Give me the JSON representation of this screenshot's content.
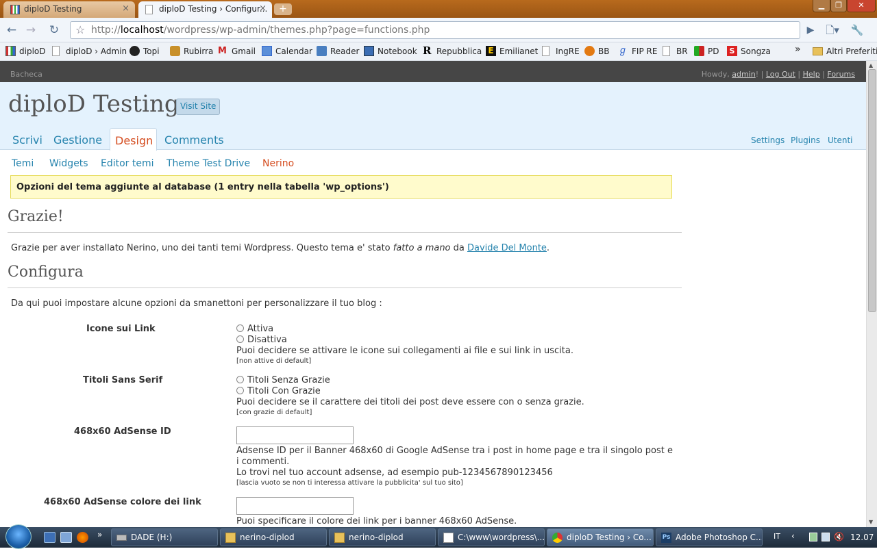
{
  "browser": {
    "tabs": [
      {
        "label": "diploD Testing",
        "active": false
      },
      {
        "label": "diploD Testing › Configur...",
        "active": true
      }
    ],
    "new_tab": "+",
    "url": {
      "prefix": "http://",
      "host": "localhost",
      "path": "/wordpress/wp-admin/themes.php?page=functions.php"
    },
    "bookmarks": [
      {
        "label": "diploD",
        "icon": "bars-icon"
      },
      {
        "label": "diploD › Admin",
        "icon": "page-icon"
      },
      {
        "label": "Topi",
        "icon": "mouse-icon"
      },
      {
        "label": "Rubirra",
        "icon": "crown-icon"
      },
      {
        "label": "Gmail",
        "icon": "gmail-icon"
      },
      {
        "label": "Calendar",
        "icon": "calendar-icon"
      },
      {
        "label": "Reader",
        "icon": "rss-icon"
      },
      {
        "label": "Notebook",
        "icon": "notebook-icon"
      },
      {
        "label": "Repubblica",
        "icon": "r-icon"
      },
      {
        "label": "Emilianet",
        "icon": "e-icon"
      },
      {
        "label": "IngRE",
        "icon": "page-icon"
      },
      {
        "label": "BB",
        "icon": "ball-icon"
      },
      {
        "label": "FIP RE",
        "icon": "figure-icon"
      },
      {
        "label": "BR",
        "icon": "page-icon"
      },
      {
        "label": "PD",
        "icon": "pd-icon"
      },
      {
        "label": "Songza",
        "icon": "s-icon"
      }
    ],
    "overflow": "»",
    "other_bookmarks": "Altri Preferiti"
  },
  "wp": {
    "topbar": {
      "dashboard": "Bacheca",
      "howdy": "Howdy, ",
      "user": "admin",
      "sep1": "! | ",
      "logout": "Log Out",
      "sep2": " | ",
      "help": "Help",
      "sep3": " | ",
      "forums": "Forums"
    },
    "blog_title": "diploD Testing",
    "visit_site": "Visit Site",
    "main_tabs": [
      "Scrivi",
      "Gestione",
      "Design",
      "Comments"
    ],
    "active_tab": "Design",
    "right_links": [
      "Settings",
      "Plugins",
      "Utenti"
    ],
    "sub_nav": [
      "Temi",
      "Widgets",
      "Editor temi",
      "Theme Test Drive",
      "Nerino"
    ],
    "active_sub": "Nerino",
    "notice": "Opzioni del tema aggiunte al database (1 entry nella tabella 'wp_options')",
    "thanks_title": "Grazie!",
    "thanks_text_1": "Grazie per aver installato Nerino, uno dei tanti temi Wordpress. Questo tema e' stato ",
    "thanks_text_em": "fatto a mano",
    "thanks_text_2": " da ",
    "thanks_link": "Davide Del Monte",
    "thanks_text_3": ".",
    "config_title": "Configura",
    "config_intro": "Da qui puoi impostare alcune opzioni da smanettoni per personalizzare il tuo blog :",
    "options": {
      "icons": {
        "label": "Icone sui Link",
        "radio1": "Attiva",
        "radio2": "Disattiva",
        "desc": "Puoi decidere se attivare le icone sui collegamenti ai file e sui link in uscita.",
        "note": "[non attive di default]"
      },
      "sans": {
        "label": "Titoli Sans Serif",
        "radio1": "Titoli Senza Grazie",
        "radio2": "Titoli Con Grazie",
        "desc": "Puoi decidere se il carattere dei titoli dei post deve essere con o senza grazie.",
        "note": "[con grazie di default]"
      },
      "adsense_id": {
        "label": "468x60 AdSense ID",
        "value": "",
        "desc1": "Adsense ID per il Banner 468x60 di Google AdSense tra i post in home page e tra il singolo post e i commenti.",
        "desc2": "Lo trovi nel tuo account adsense, ad esempio pub-1234567890123456",
        "note": "[lascia vuoto se non ti interessa attivare la pubblicita' sul tuo sito]"
      },
      "adsense_color": {
        "label": "468x60 AdSense colore dei link",
        "value": "",
        "desc": "Puoi specificare il colore dei link per i banner 468x60 AdSense."
      }
    }
  },
  "taskbar": {
    "tasks": [
      {
        "label": "DADE (H:)",
        "icon": "drive-icon"
      },
      {
        "label": "nerino-diplod",
        "icon": "folder-icon"
      },
      {
        "label": "nerino-diplod",
        "icon": "folder-icon"
      },
      {
        "label": "C:\\www\\wordpress\\...",
        "icon": "editor-icon"
      },
      {
        "label": "diploD Testing › Co...",
        "icon": "chrome-icon"
      },
      {
        "label": "Adobe Photoshop C...",
        "icon": "photoshop-icon"
      }
    ],
    "language": "IT",
    "clock": "12.07"
  },
  "colors": {
    "link": "#2583ad",
    "active": "#d54e21",
    "header_bg": "#e4f2fd",
    "notice_bg": "#fffbcc"
  }
}
